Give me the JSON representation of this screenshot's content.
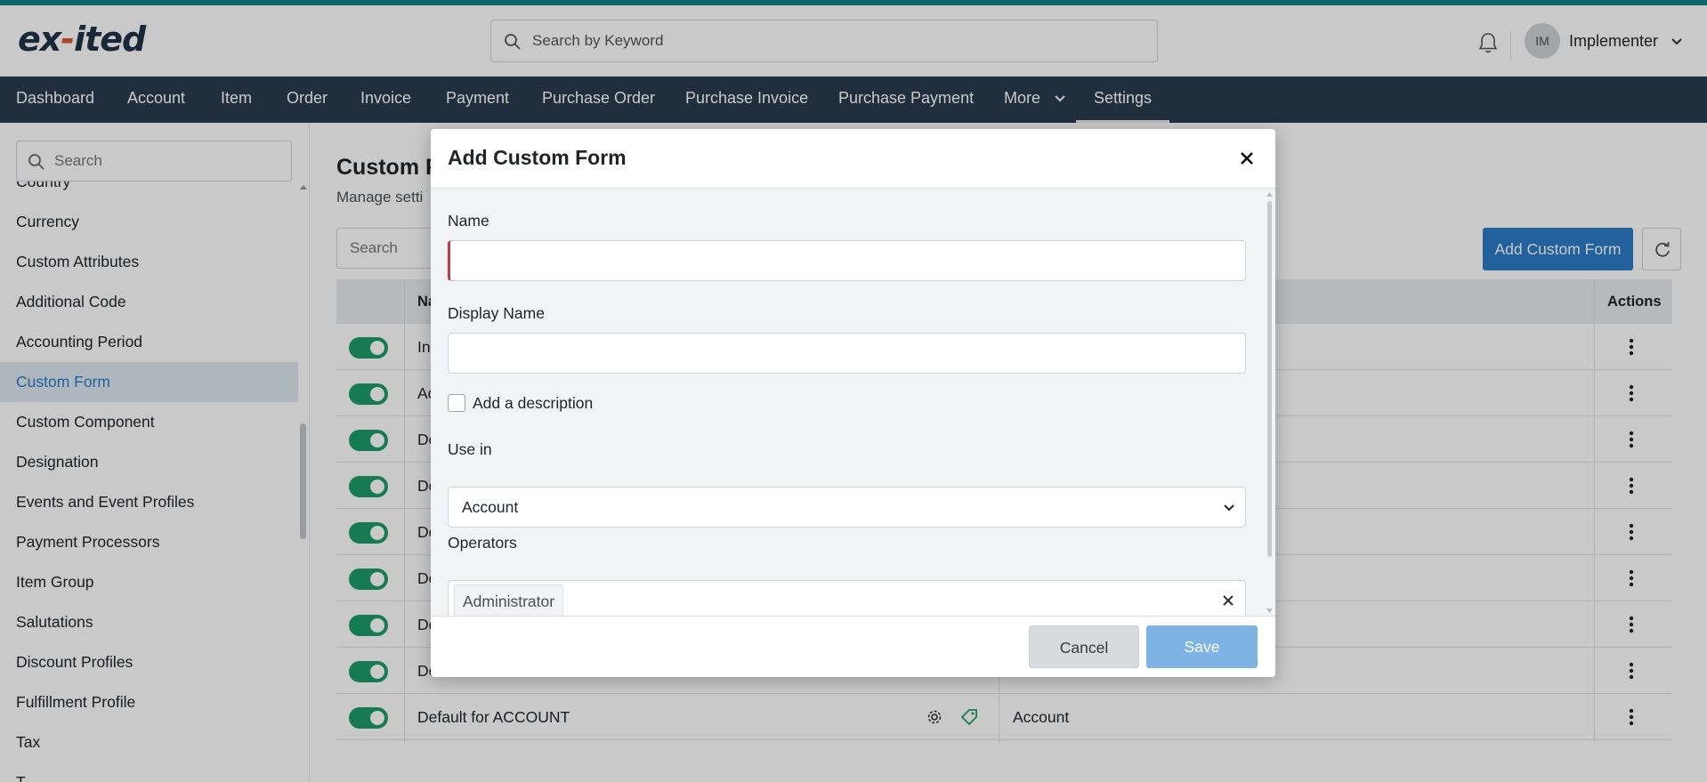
{
  "header": {
    "logo_text_a": "ex",
    "logo_text_dash": "-",
    "logo_text_b": "ited",
    "search_placeholder": "Search by Keyword",
    "user_initials": "IM",
    "user_name": "Implementer"
  },
  "nav": {
    "items": [
      "Dashboard",
      "Account",
      "Item",
      "Order",
      "Invoice",
      "Payment",
      "Purchase Order",
      "Purchase Invoice",
      "Purchase Payment",
      "More",
      "Settings"
    ],
    "active": "Settings"
  },
  "sidebar": {
    "search_placeholder": "Search",
    "items": [
      "Country",
      "Currency",
      "Custom Attributes",
      "Additional Code",
      "Accounting Period",
      "Custom Form",
      "Custom Component",
      "Designation",
      "Events and Event Profiles",
      "Payment Processors",
      "Item Group",
      "Salutations",
      "Discount Profiles",
      "Fulfillment Profile",
      "Tax",
      "T"
    ],
    "active": "Custom Form"
  },
  "page": {
    "title": "Custom F",
    "subtitle": "Manage setti",
    "search_placeholder": "Search",
    "add_button": "Add Custom Form"
  },
  "table": {
    "headers": {
      "name": "Na",
      "actions": "Actions"
    },
    "rows": [
      {
        "name": "In",
        "use_in": ""
      },
      {
        "name": "Ac",
        "use_in": ""
      },
      {
        "name": "De",
        "use_in": ""
      },
      {
        "name": "De",
        "use_in": ""
      },
      {
        "name": "De",
        "use_in": ""
      },
      {
        "name": "De",
        "use_in": ""
      },
      {
        "name": "De",
        "use_in": ""
      },
      {
        "name": "De",
        "use_in": ""
      },
      {
        "name": "Default for ACCOUNT",
        "use_in": "Account"
      }
    ]
  },
  "modal": {
    "title": "Add Custom Form",
    "name_label": "Name",
    "name_value": "",
    "display_name_label": "Display Name",
    "display_name_value": "",
    "description_label": "Add a description",
    "description_checked": false,
    "use_in_label": "Use in",
    "use_in_value": "Account",
    "operators_label": "Operators",
    "operators_selected": [
      "Administrator"
    ],
    "cancel_label": "Cancel",
    "save_label": "Save"
  },
  "colors": {
    "accent_teal": "#138286",
    "nav_bg": "#2b3b4e",
    "primary": "#2d7cc6",
    "toggle_on": "#1d9c6a",
    "save_disabled": "#7eb3e6"
  }
}
